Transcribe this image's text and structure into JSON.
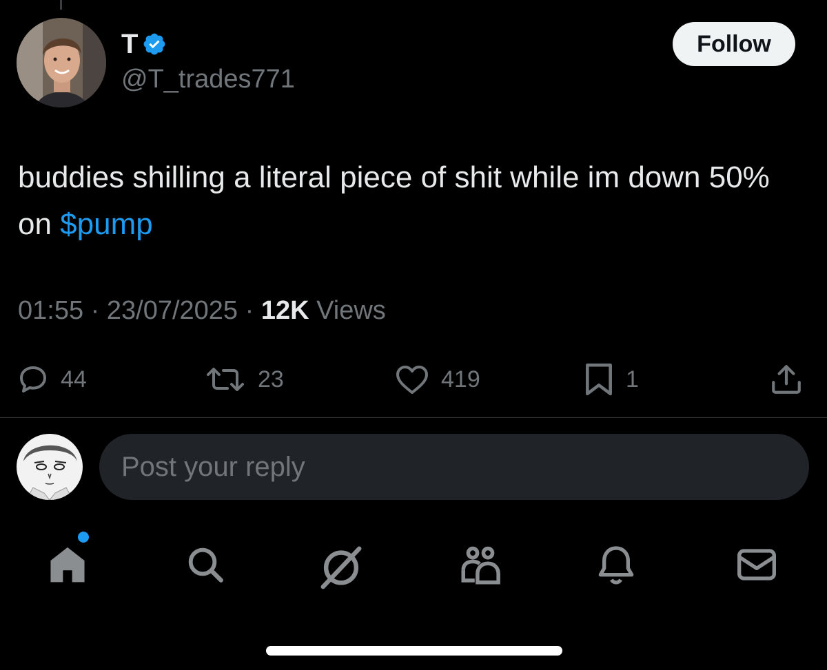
{
  "tweet": {
    "author": {
      "name": "T",
      "handle": "@T_trades771",
      "avatar_icon": "user-avatar-photo",
      "verified_icon": "verified-badge-icon"
    },
    "follow_label": "Follow",
    "text_plain": "buddies shilling a literal piece of shit while im down 50% on ",
    "cashtag": "$pump",
    "time": "01:55",
    "date": "23/07/2025",
    "separator": " · ",
    "views_count": "12K",
    "views_label": " Views",
    "actions": {
      "replies": "44",
      "reposts": "23",
      "likes": "419",
      "bookmarks": "1"
    }
  },
  "reply": {
    "placeholder": "Post your reply",
    "avatar_icon": "reply-user-avatar"
  },
  "bottom_nav": {
    "items": [
      "home-icon",
      "search-icon",
      "grok-icon",
      "communities-icon",
      "notifications-icon",
      "messages-icon"
    ],
    "home_has_notification": true
  },
  "colors": {
    "background": "#000000",
    "text_primary": "#e7e9ea",
    "text_secondary": "#71767b",
    "accent": "#1d9bf0",
    "divider": "#2f3336",
    "reply_box": "#202327",
    "follow_button_bg": "#eff3f4",
    "follow_button_text": "#0f1419"
  }
}
